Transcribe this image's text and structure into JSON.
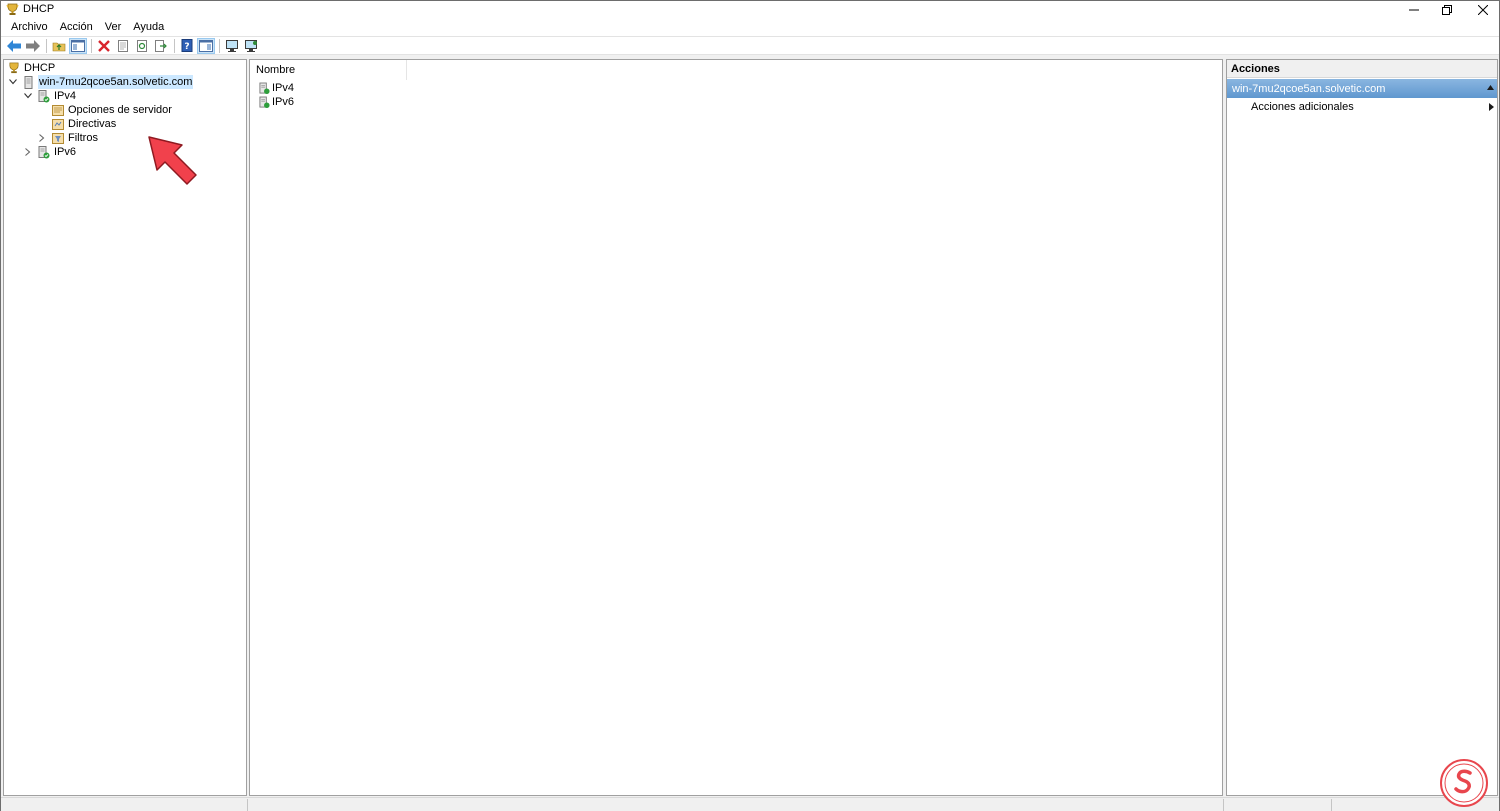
{
  "window": {
    "title": "DHCP",
    "app_icon": "dhcp-trophy-icon",
    "controls": {
      "minimize": "minimize-icon",
      "restore": "restore-icon",
      "close": "close-icon"
    }
  },
  "menu": {
    "items": [
      "Archivo",
      "Acción",
      "Ver",
      "Ayuda"
    ]
  },
  "toolbar": {
    "buttons": [
      "back-arrow-icon",
      "forward-arrow-icon",
      "up-folder-icon",
      "show-hide-tree-icon",
      "delete-icon",
      "properties-icon",
      "refresh-icon",
      "export-list-icon",
      "help-icon",
      "show-hide-action-pane-icon",
      "add-server-icon",
      "remove-server-icon"
    ]
  },
  "tree": {
    "root": "DHCP",
    "server": "win-7mu2qcoe5an.solvetic.com",
    "ipv4": "IPv4",
    "server_options": "Opciones de servidor",
    "policies": "Directivas",
    "filters": "Filtros",
    "ipv6": "IPv6"
  },
  "list": {
    "column_header": "Nombre",
    "rows": [
      "IPv4",
      "IPv6"
    ]
  },
  "actions": {
    "header": "Acciones",
    "section": "win-7mu2qcoe5an.solvetic.com",
    "more_actions": "Acciones adicionales"
  },
  "colors": {
    "selection": "#cce8ff",
    "actions_section": "#6fa3d8",
    "annotation_arrow": "#f1414c",
    "logo": "#e8464d"
  }
}
